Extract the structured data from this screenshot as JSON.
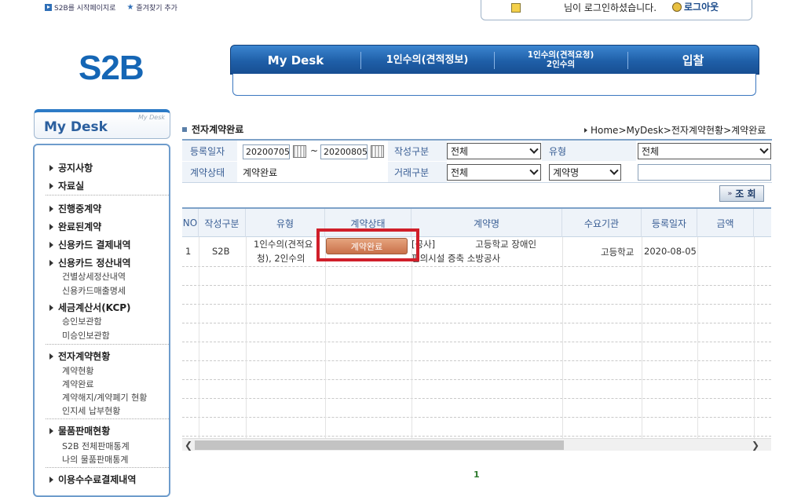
{
  "top_links": {
    "start_page": "S2B를 시작페이지로",
    "bookmark": "즐겨찾기 추가"
  },
  "login": {
    "message": "님이 로그인하셨습니다.",
    "logout": "로그아웃"
  },
  "logo": "S2B",
  "main_nav": [
    {
      "label": "My Desk"
    },
    {
      "label": "1인수의(견적정보)"
    },
    {
      "label": "1인수의(견적요청)\n2인수의"
    },
    {
      "label": "입찰"
    }
  ],
  "sidebar": {
    "title": "My Desk",
    "title_small": "My Desk",
    "items": [
      {
        "label": "공지사항"
      },
      {
        "label": "자료실"
      },
      {
        "label": "진행중계약"
      },
      {
        "label": "완료된계약"
      },
      {
        "label": "신용카드 결제내역"
      },
      {
        "label": "신용카드 정산내역"
      },
      {
        "label": "건별상세정산내역"
      },
      {
        "label": "신용카드매출명세"
      },
      {
        "label": "세금계산서(KCP)"
      },
      {
        "label": "승인보관함"
      },
      {
        "label": "미승인보관함"
      },
      {
        "label": "전자계약현황"
      },
      {
        "label": "계약현황"
      },
      {
        "label": "계약완료"
      },
      {
        "label": "계약해지/계약폐기 현황"
      },
      {
        "label": "인지세 납부현황"
      },
      {
        "label": "물품판매현황"
      },
      {
        "label": "S2B 전체판매통계"
      },
      {
        "label": "나의 물품판매통계"
      },
      {
        "label": "이용수수료결제내역"
      }
    ]
  },
  "section_title": "전자계약완료",
  "breadcrumb": "Home>MyDesk>전자계약현황>계약완료",
  "filter": {
    "reg_date_label": "등록일자",
    "date_from": "20200705",
    "date_sep": "~",
    "date_to": "20200805",
    "write_type_label": "작성구분",
    "write_type_value": "전체",
    "type_label": "유형",
    "type_value": "전체",
    "contract_status_label": "계약상태",
    "contract_status_value": "계약완료",
    "trade_type_label": "거래구분",
    "trade_type_value": "전체",
    "contract_name_select": "계약명",
    "contract_name_input": ""
  },
  "search_button": "조 회",
  "table": {
    "headers": [
      "NO",
      "작성구분",
      "유형",
      "계약상태",
      "계약명",
      "수요기관",
      "등록일자",
      "금액"
    ],
    "rows": [
      {
        "no": "1",
        "write_type": "S2B",
        "type_line1": "1인수의(견적요",
        "type_line2": "청), 2인수의",
        "status": "계약완료",
        "name_line1": "[공사]              고등학교 장애인",
        "name_line2": "편의시설 증축 소방공사",
        "agency": "고등학교",
        "reg_date": "2020-08-05",
        "amount": ""
      }
    ]
  },
  "pagination": {
    "current": "1"
  },
  "colors": {
    "accent": "#1f5fa8",
    "highlight": "#d01f2a",
    "status_button": "#c9714a"
  }
}
